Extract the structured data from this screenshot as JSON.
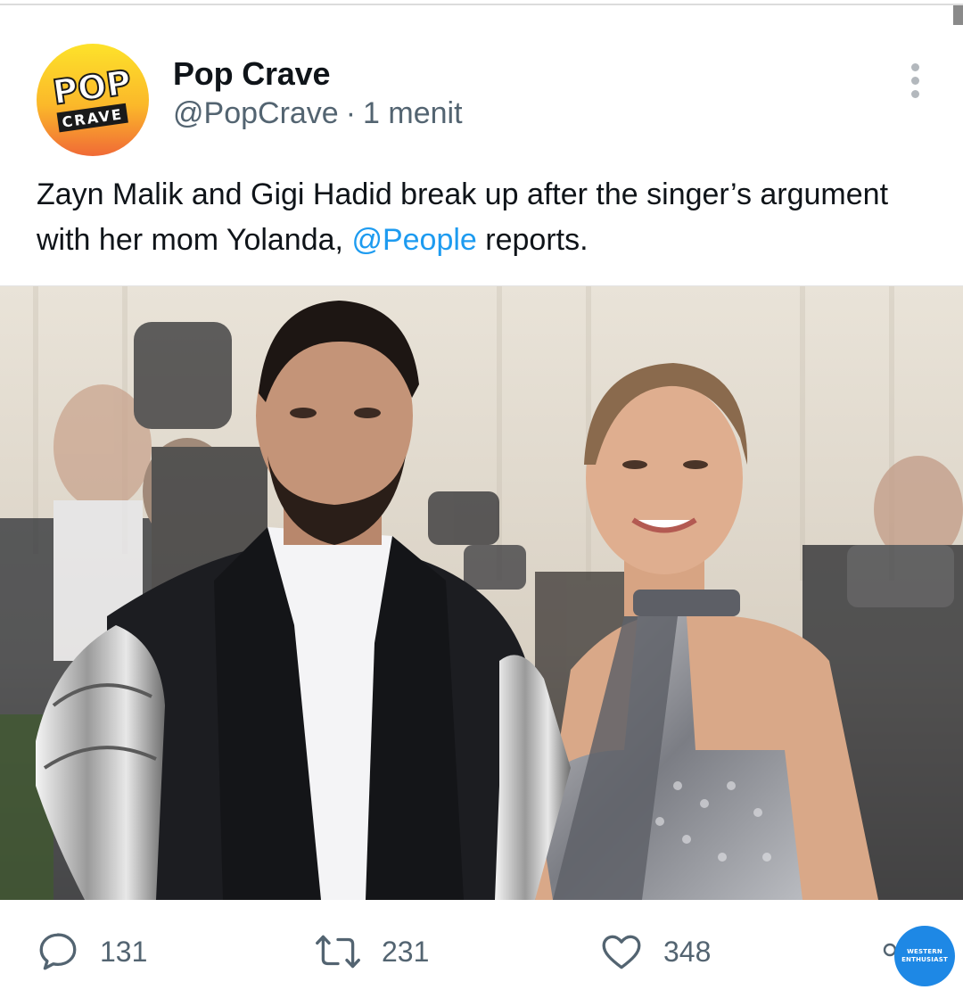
{
  "author": {
    "display_name": "Pop Crave",
    "handle": "@PopCrave",
    "separator": "·",
    "time": "1 menit",
    "avatar_text_top": "POP",
    "avatar_text_bottom": "CRAVE"
  },
  "tweet": {
    "text_before": "Zayn Malik and Gigi Hadid break up after the singer’s argument with her mom Yolanda, ",
    "mention": "@People",
    "text_after": " reports."
  },
  "media": {
    "description_icon": "photo"
  },
  "actions": {
    "reply_count": "131",
    "retweet_count": "231",
    "like_count": "348"
  },
  "watermark": {
    "line1": "WESTERN",
    "line2": "ENTHUSIAST"
  },
  "colors": {
    "link": "#1d9bf0",
    "secondary_text": "#536471",
    "avatar_yellow": "#fbd01e",
    "avatar_orange": "#f0592b"
  },
  "icons": {
    "reply": "reply-icon",
    "retweet": "retweet-icon",
    "like": "heart-icon",
    "more": "more-dots-icon",
    "share": "share-icon"
  }
}
